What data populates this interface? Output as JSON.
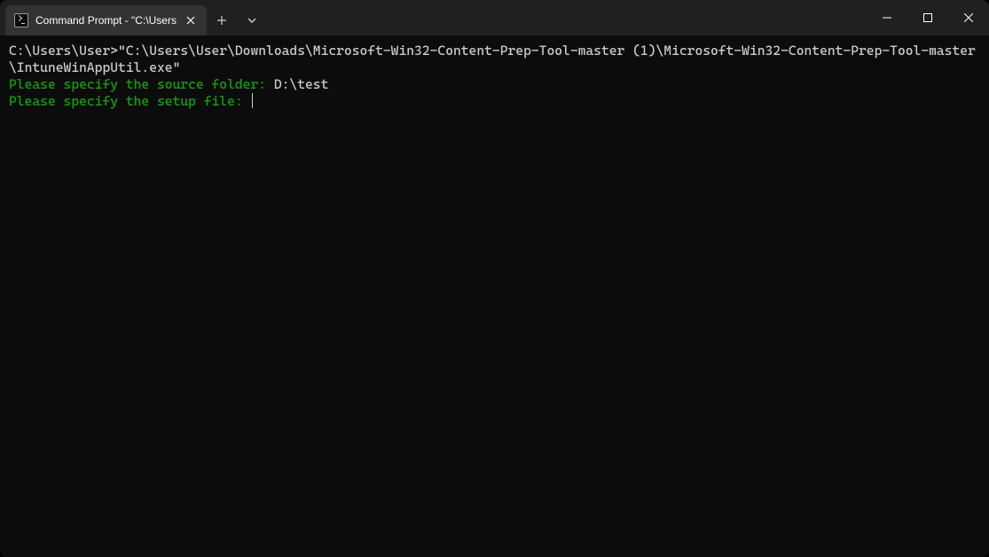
{
  "titlebar": {
    "tab_title": "Command Prompt - \"C:\\Users"
  },
  "terminal": {
    "line1_prompt": "C:\\Users\\User>",
    "line1_cmd": "\"C:\\Users\\User\\Downloads\\Microsoft-Win32-Content-Prep-Tool-master (1)\\Microsoft-Win32-Content-Prep-Tool-master\\IntuneWinAppUtil.exe\"",
    "line2_prompt": "Please specify the source folder: ",
    "line2_input": "D:\\test",
    "line3_prompt": "Please specify the setup file: "
  },
  "icons": {
    "cmd": "cmd-icon",
    "close": "close-icon",
    "plus": "plus-icon",
    "chevron_down": "chevron-down-icon",
    "minimize": "minimize-icon",
    "maximize": "maximize-icon",
    "window_close": "window-close-icon"
  }
}
